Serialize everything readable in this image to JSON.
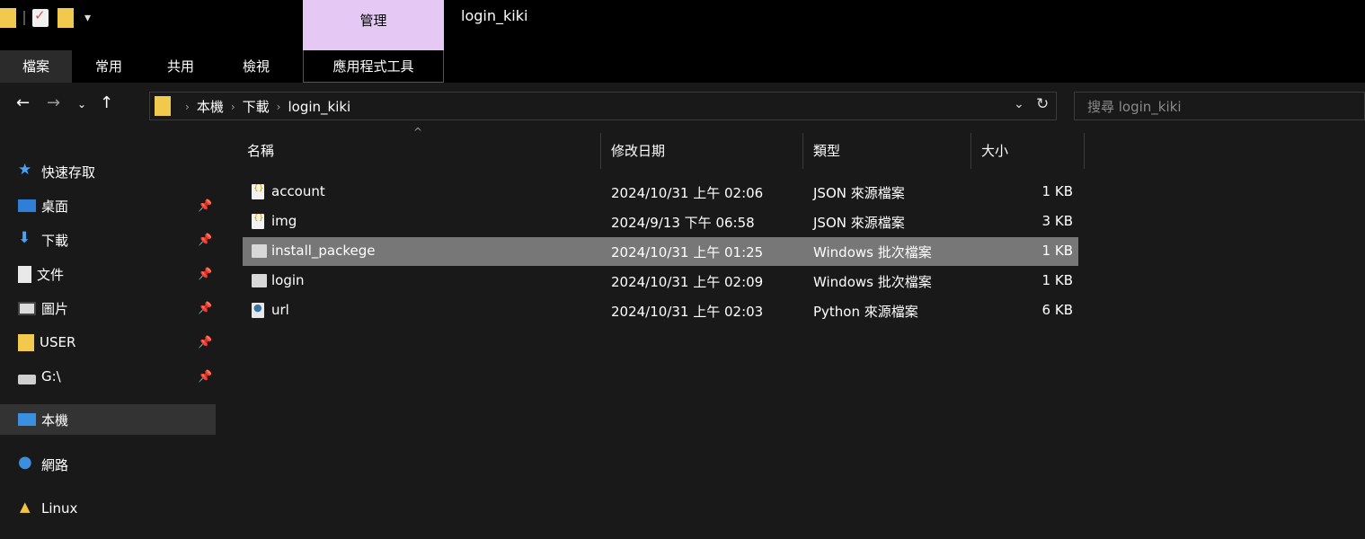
{
  "window": {
    "title": "login_kiki",
    "context_tab": "管理"
  },
  "ribbon": {
    "tabs": [
      "檔案",
      "常用",
      "共用",
      "檢視",
      "應用程式工具"
    ]
  },
  "address": {
    "crumbs": [
      "本機",
      "下載",
      "login_kiki"
    ],
    "search_placeholder": "搜尋 login_kiki"
  },
  "sidebar": {
    "items": [
      {
        "label": "快速存取",
        "icon": "star-icon"
      },
      {
        "label": "桌面",
        "icon": "desktop-icon",
        "pinned": true
      },
      {
        "label": "下載",
        "icon": "download-icon",
        "pinned": true
      },
      {
        "label": "文件",
        "icon": "document-icon",
        "pinned": true
      },
      {
        "label": "圖片",
        "icon": "picture-icon",
        "pinned": true
      },
      {
        "label": "USER",
        "icon": "folder-icon",
        "pinned": true
      },
      {
        "label": "G:\\",
        "icon": "network-drive-icon",
        "pinned": true
      },
      {
        "label": "本機",
        "icon": "this-pc-icon"
      },
      {
        "label": "網路",
        "icon": "network-icon"
      },
      {
        "label": "Linux",
        "icon": "linux-icon"
      }
    ]
  },
  "columns": {
    "name": "名稱",
    "modified": "修改日期",
    "type": "類型",
    "size": "大小"
  },
  "files": [
    {
      "name": "account",
      "modified": "2024/10/31 上午 02:06",
      "type": "JSON 來源檔案",
      "size": "1 KB",
      "icon": "json-file-icon"
    },
    {
      "name": "img",
      "modified": "2024/9/13 下午 06:58",
      "type": "JSON 來源檔案",
      "size": "3 KB",
      "icon": "json-file-icon"
    },
    {
      "name": "install_packege",
      "modified": "2024/10/31 上午 01:25",
      "type": "Windows 批次檔案",
      "size": "1 KB",
      "icon": "batch-file-icon",
      "selected": true
    },
    {
      "name": "login",
      "modified": "2024/10/31 上午 02:09",
      "type": "Windows 批次檔案",
      "size": "1 KB",
      "icon": "batch-file-icon"
    },
    {
      "name": "url",
      "modified": "2024/10/31 上午 02:03",
      "type": "Python 來源檔案",
      "size": "6 KB",
      "icon": "python-file-icon"
    }
  ]
}
